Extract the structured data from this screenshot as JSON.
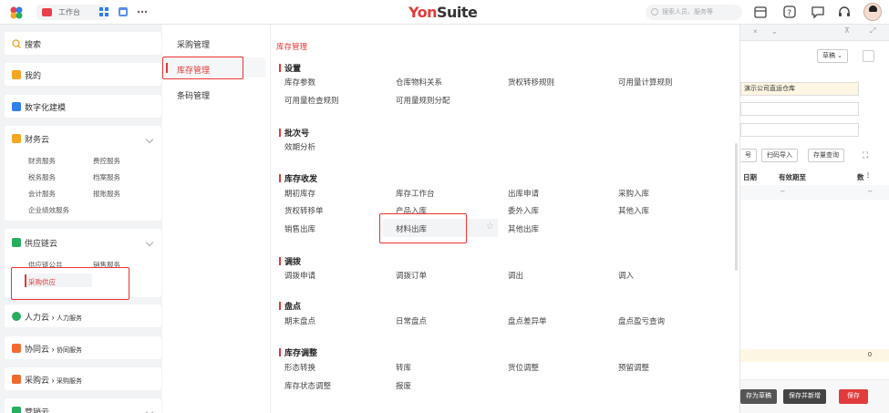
{
  "topbar": {
    "tab_label": "工作台",
    "brand_main": "Yon",
    "brand_rest": "Suite",
    "search_placeholder": "搜索人员、服务等"
  },
  "sidebar": {
    "search_label": "搜索",
    "mine_label": "我的",
    "digital_label": "数字化建模",
    "finance": {
      "label": "财务云",
      "items": [
        "财资服务",
        "费控服务",
        "税务服务",
        "档案服务",
        "会计服务",
        "报账服务",
        "企业绩效服务"
      ]
    },
    "supply": {
      "label": "供应链云",
      "items": [
        "供应链公共",
        "销售服务",
        "采购供应"
      ]
    },
    "hr": {
      "label": "人力云",
      "sub": "人力服务"
    },
    "collab": {
      "label": "协同云",
      "sub": "协同服务"
    },
    "purchase": {
      "label": "采购云",
      "sub": "采购服务"
    },
    "marketing": {
      "label": "营销云"
    }
  },
  "menu": {
    "col1": [
      "采购管理",
      "库存管理",
      "条码管理"
    ],
    "breadcrumb": "库存管理",
    "sections": [
      {
        "title": "设置",
        "items": [
          "库存参数",
          "仓库物料关系",
          "货权转移规则",
          "可用量计算规则",
          "可用量检查规则",
          "可用量规则分配"
        ]
      },
      {
        "title": "批次号",
        "items": [
          "效期分析"
        ]
      },
      {
        "title": "库存收发",
        "items": [
          "期初库存",
          "库存工作台",
          "出库申请",
          "采购入库",
          "货权转移单",
          "产品入库",
          "委外入库",
          "其他入库",
          "销售出库",
          "材料出库",
          "其他出库"
        ]
      },
      {
        "title": "调拨",
        "items": [
          "调拨申请",
          "调拨订单",
          "调出",
          "调入"
        ]
      },
      {
        "title": "盘点",
        "items": [
          "期末盘点",
          "日常盘点",
          "盘点差异单",
          "盘点盈亏查询"
        ]
      },
      {
        "title": "库存调整",
        "items": [
          "形态转换",
          "转库",
          "货位调整",
          "预留调整",
          "库存状态调整",
          "报废"
        ]
      }
    ]
  },
  "right": {
    "draft_btn": "草稿",
    "warehouse": "演示公司直运仓库",
    "btn_scan": "扫码导入",
    "btn_stock": "存量查询",
    "btn_num": "号",
    "col_date": "日期",
    "col_expire": "有效期至",
    "col_last": "数",
    "dash": "--",
    "zero": "0",
    "save_draft": "存为草稿",
    "save_new": "保存并新增",
    "save": "保存"
  }
}
